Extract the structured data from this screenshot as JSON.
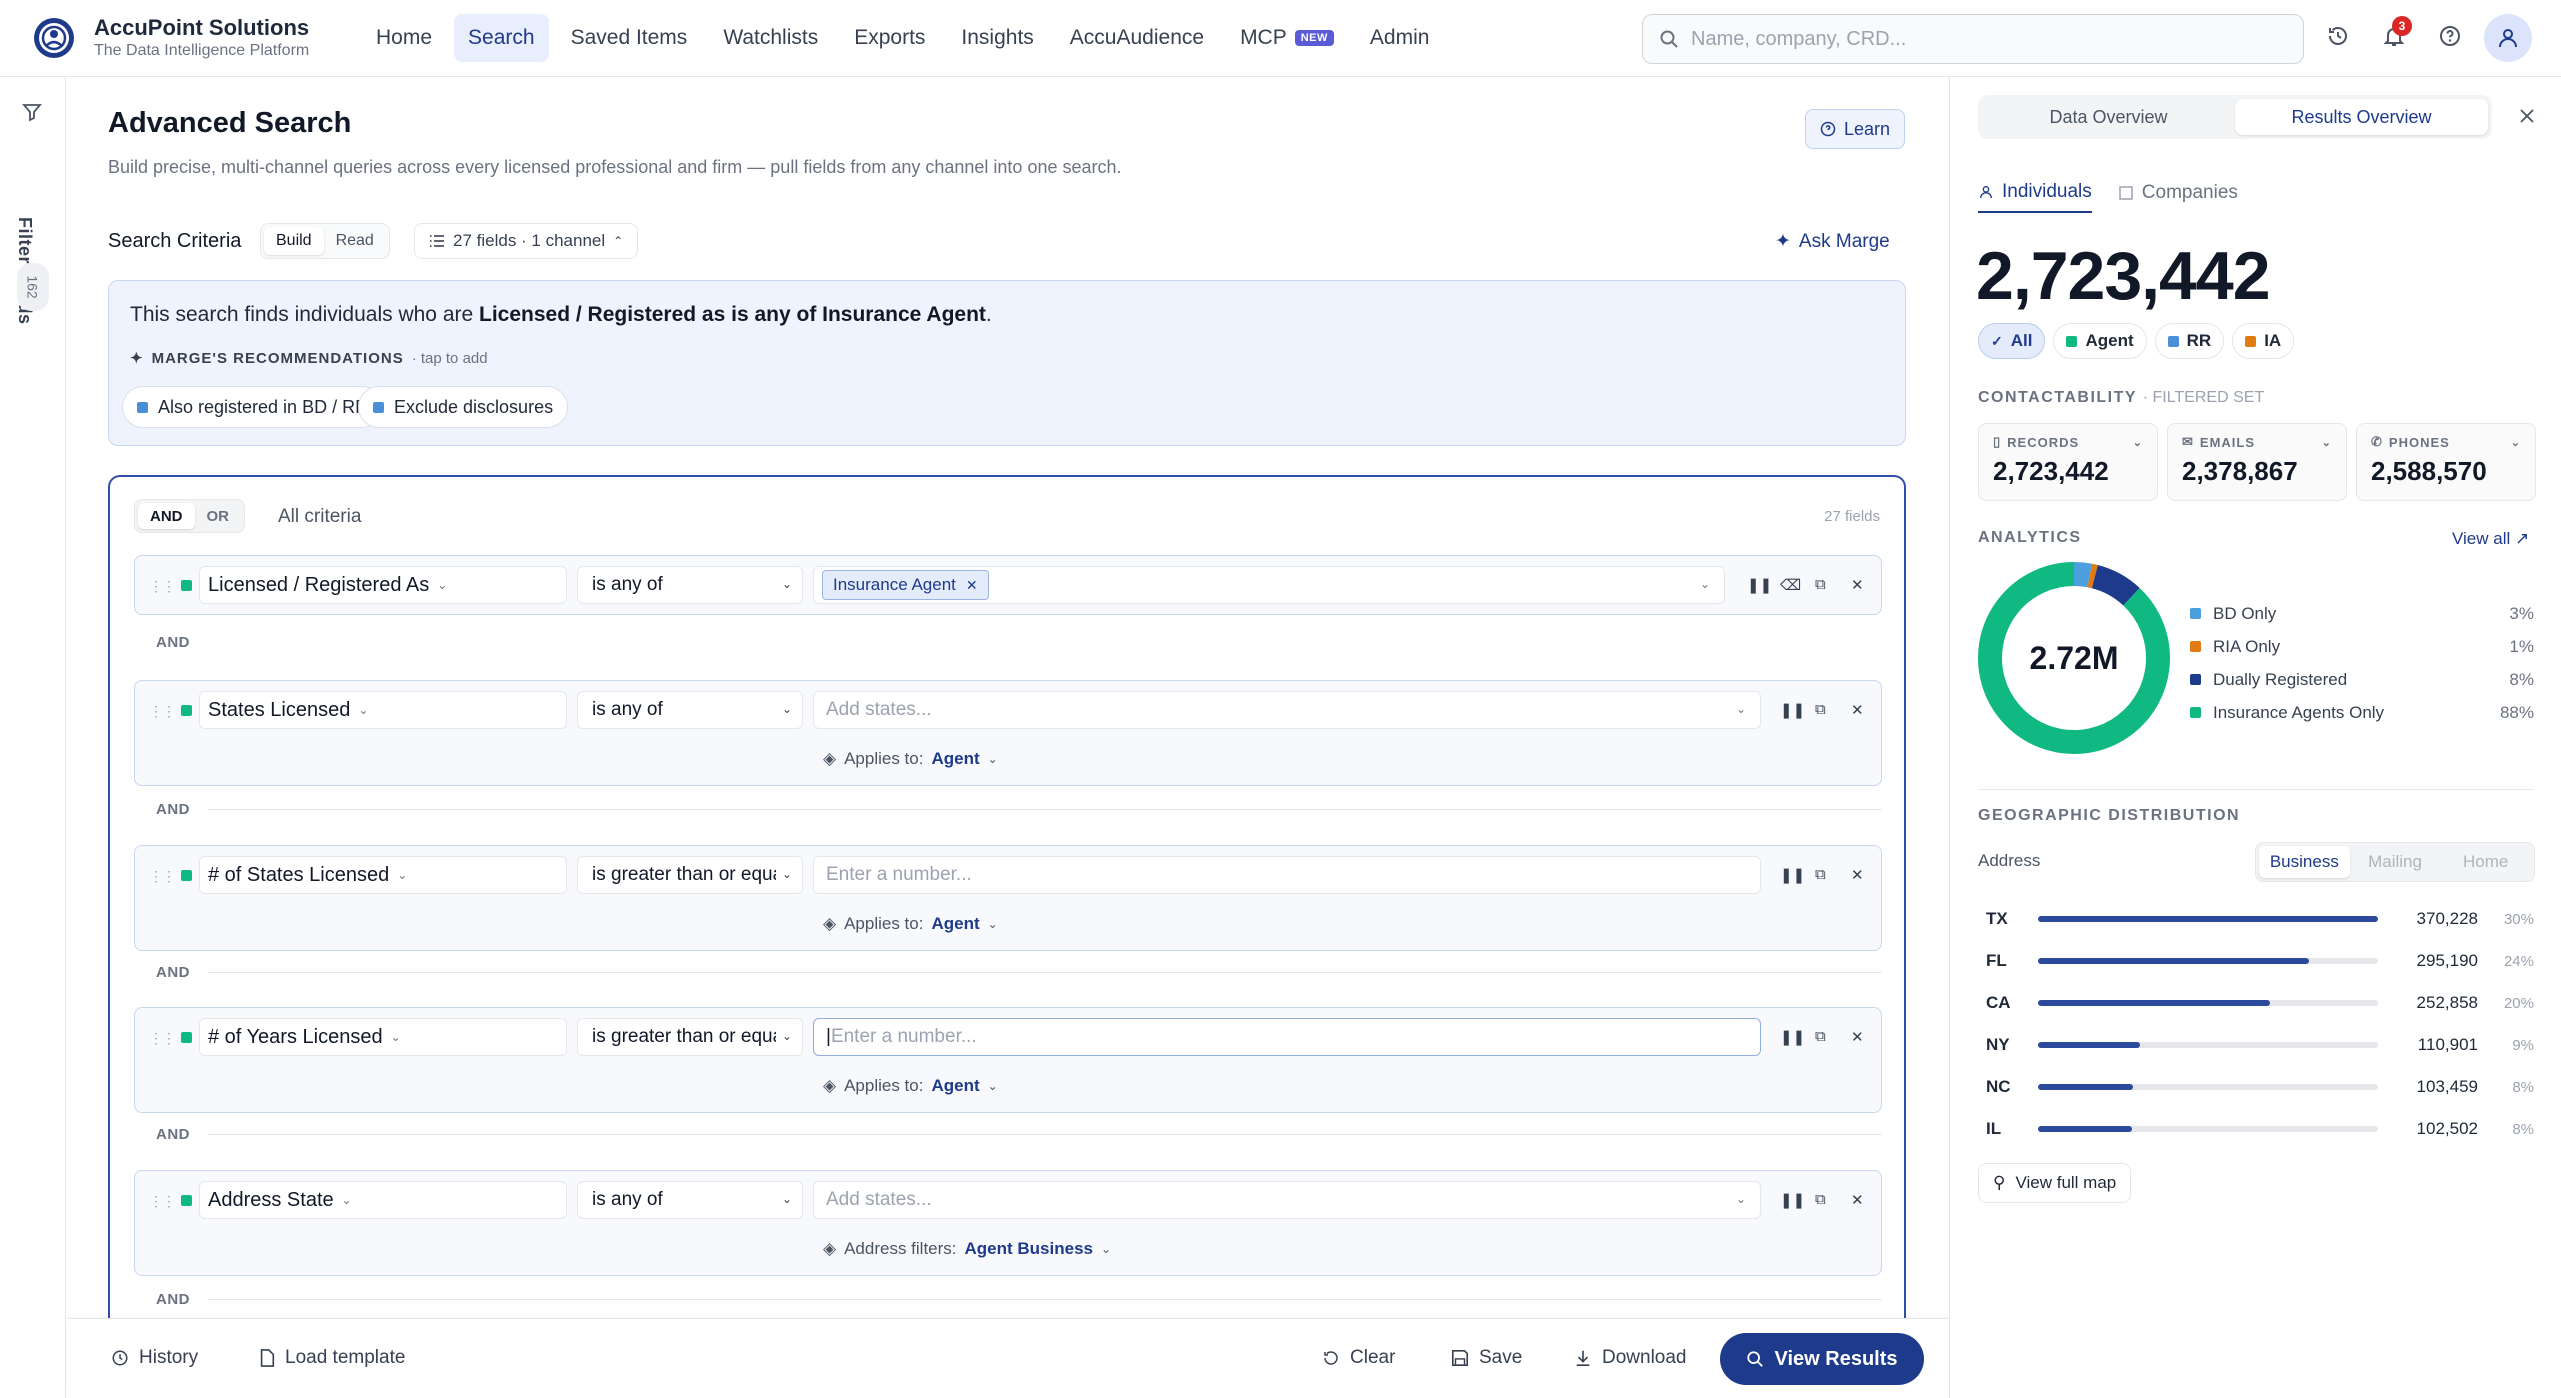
{
  "app": {
    "name": "AccuPoint Solutions",
    "tagline": "The Data Intelligence Platform",
    "nav": [
      {
        "label": "Home"
      },
      {
        "label": "Search",
        "active": true
      },
      {
        "label": "Saved Items"
      },
      {
        "label": "Watchlists"
      },
      {
        "label": "Exports"
      },
      {
        "label": "Insights"
      },
      {
        "label": "AccuAudience"
      },
      {
        "label": "MCP",
        "badge": "NEW"
      },
      {
        "label": "Admin"
      }
    ],
    "search_placeholder": "Name, company, CRD...",
    "notification_count": "3"
  },
  "rail": {
    "label": "Filter Fields",
    "count": "162"
  },
  "page": {
    "title": "Advanced Search",
    "description": "Build precise, multi-channel queries across every licensed professional and firm — pull fields from any channel into one search.",
    "learn_label": "Learn",
    "criteria_label": "Search Criteria",
    "mode_build": "Build",
    "mode_read": "Read",
    "fields_summary": "27 fields · 1 channel",
    "ask_marge": "Ask Marge"
  },
  "summary": {
    "prefix": "This search finds individuals who are ",
    "bold": "Licensed / Registered as is any of Insurance Agent",
    "suffix": ".",
    "recs_title": "MARGE'S RECOMMENDATIONS",
    "recs_hint": "· tap to add",
    "recs": [
      "Also registered in BD / RR",
      "Exclude disclosures"
    ]
  },
  "builder": {
    "and_label": "AND",
    "or_label": "OR",
    "all_criteria": "All criteria",
    "fields_count": "27 fields",
    "separator": "AND",
    "applies_label": "Applies to:",
    "address_filters_label": "Address filters:",
    "rows": [
      {
        "field": "Licensed / Registered As",
        "operator": "is any of",
        "tag": "Insurance Agent"
      },
      {
        "field": "States Licensed",
        "operator": "is any of",
        "placeholder": "Add states...",
        "applies": "Agent"
      },
      {
        "field": "# of States Licensed",
        "operator": "is greater than or equal to",
        "placeholder": "Enter a number...",
        "applies": "Agent"
      },
      {
        "field": "# of Years Licensed",
        "operator": "is greater than or equal to",
        "placeholder": "Enter a number...",
        "applies": "Agent"
      },
      {
        "field": "Address State",
        "operator": "is any of",
        "placeholder": "Add states...",
        "address_filters": "Agent Business"
      }
    ]
  },
  "bottom": {
    "history": "History",
    "load_template": "Load template",
    "clear": "Clear",
    "save": "Save",
    "download": "Download",
    "view_results": "View Results"
  },
  "panel": {
    "tab_data": "Data Overview",
    "tab_results": "Results Overview",
    "sub_individuals": "Individuals",
    "sub_companies": "Companies",
    "total": "2,723,442",
    "chips": [
      {
        "label": "All",
        "color": ""
      },
      {
        "label": "Agent",
        "color": "#10b981"
      },
      {
        "label": "RR",
        "color": "#4a90d9"
      },
      {
        "label": "IA",
        "color": "#e07b12"
      }
    ],
    "contactability_title": "CONTACTABILITY",
    "contactability_sub": "· FILTERED SET",
    "stats": [
      {
        "label": "RECORDS",
        "value": "2,723,442"
      },
      {
        "label": "EMAILS",
        "value": "2,378,867"
      },
      {
        "label": "PHONES",
        "value": "2,588,570"
      }
    ],
    "analytics_title": "ANALYTICS",
    "view_all": "View all ↗",
    "donut_center": "2.72M",
    "breakdown": [
      {
        "label": "BD Only",
        "pct": "3%",
        "value": 3,
        "color": "#4a9fdc"
      },
      {
        "label": "RIA Only",
        "pct": "1%",
        "value": 1,
        "color": "#e07b12"
      },
      {
        "label": "Dually Registered",
        "pct": "8%",
        "value": 8,
        "color": "#1e3a8a"
      },
      {
        "label": "Insurance Agents Only",
        "pct": "88%",
        "value": 88,
        "color": "#10b981"
      }
    ],
    "geo_title": "GEOGRAPHIC DISTRIBUTION",
    "address_label": "Address",
    "address_tabs": [
      "Business",
      "Mailing",
      "Home"
    ],
    "geo": [
      {
        "state": "TX",
        "count": "370,228",
        "pct": "30%",
        "share": 1.0
      },
      {
        "state": "FL",
        "count": "295,190",
        "pct": "24%",
        "share": 0.797
      },
      {
        "state": "CA",
        "count": "252,858",
        "pct": "20%",
        "share": 0.683
      },
      {
        "state": "NY",
        "count": "110,901",
        "pct": "9%",
        "share": 0.3
      },
      {
        "state": "NC",
        "count": "103,459",
        "pct": "8%",
        "share": 0.279
      },
      {
        "state": "IL",
        "count": "102,502",
        "pct": "8%",
        "share": 0.277
      }
    ],
    "view_map": "View full map"
  }
}
